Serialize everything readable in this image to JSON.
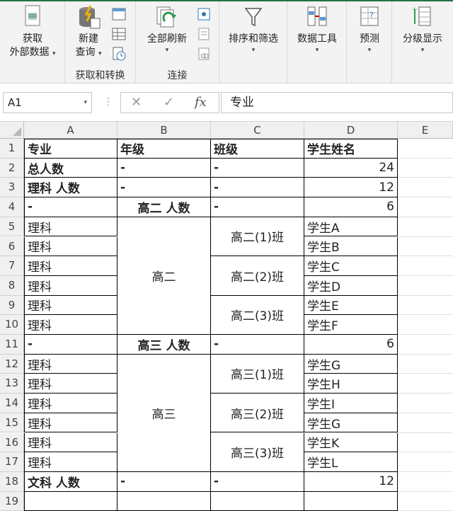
{
  "ribbon": {
    "groups": [
      {
        "label": ""
      },
      {
        "label": "获取和转换"
      },
      {
        "label": "连接"
      },
      {
        "label": ""
      },
      {
        "label": ""
      },
      {
        "label": ""
      },
      {
        "label": ""
      }
    ],
    "buttons": {
      "get_external_1": "获取",
      "get_external_2": "外部数据",
      "new_query_1": "新建",
      "new_query_2": "查询",
      "refresh_all": "全部刷新",
      "sort_filter": "排序和筛选",
      "data_tools": "数据工具",
      "forecast": "预测",
      "outline": "分级显示"
    }
  },
  "formula_bar": {
    "name_box": "A1",
    "cancel": "✕",
    "enter": "✓",
    "fx": "fx",
    "formula": "专业"
  },
  "columns": [
    "A",
    "B",
    "C",
    "D",
    "E"
  ],
  "rows": [
    "1",
    "2",
    "3",
    "4",
    "5",
    "6",
    "7",
    "8",
    "9",
    "10",
    "11",
    "12",
    "13",
    "14",
    "15",
    "16",
    "17",
    "18",
    "19"
  ],
  "cells": {
    "A1": "专业",
    "B1": "年级",
    "C1": "班级",
    "D1": "学生姓名",
    "A2": "总人数",
    "B2": "-",
    "C2": "-",
    "D2": "24",
    "A3": "理科 人数",
    "B3": "-",
    "C3": "-",
    "D3": "12",
    "A4": "-",
    "B4": "高二 人数",
    "C4": "-",
    "D4": "6",
    "A5": "理科",
    "A6": "理科",
    "A7": "理科",
    "A8": "理科",
    "A9": "理科",
    "A10": "理科",
    "B5": "高二",
    "C5": "高二(1)班",
    "C7": "高二(2)班",
    "C9": "高二(3)班",
    "D5": "学生A",
    "D6": "学生B",
    "D7": "学生C",
    "D8": "学生D",
    "D9": "学生E",
    "D10": "学生F",
    "A11": "-",
    "B11": "高三 人数",
    "C11": "-",
    "D11": "6",
    "A12": "理科",
    "A13": "理科",
    "A14": "理科",
    "A15": "理科",
    "A16": "理科",
    "A17": "理科",
    "B12": "高三",
    "C12": "高三(1)班",
    "C14": "高三(2)班",
    "C16": "高三(3)班",
    "D12": "学生G",
    "D13": "学生H",
    "D14": "学生I",
    "D15": "学生G",
    "D16": "学生K",
    "D17": "学生L",
    "A18": "文科 人数",
    "B18": "-",
    "C18": "-",
    "D18": "12"
  }
}
